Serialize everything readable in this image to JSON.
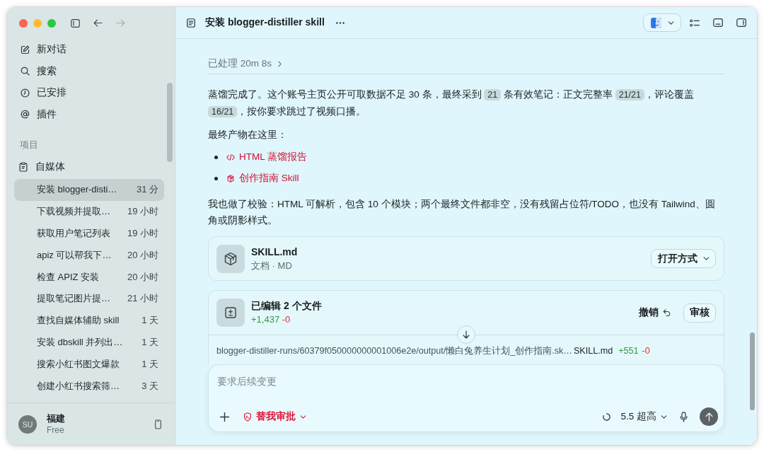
{
  "toolbar": {
    "back": {
      "disabled": false
    },
    "forward": {
      "disabled": true
    }
  },
  "sidebar": {
    "menu": [
      {
        "label": "新对话",
        "kind": "new"
      },
      {
        "label": "搜索",
        "kind": "search"
      },
      {
        "label": "已安排",
        "kind": "scheduled"
      },
      {
        "label": "插件",
        "kind": "plugins"
      }
    ],
    "section_label": "项目",
    "project": {
      "name": "自媒体",
      "threads": [
        {
          "title": "安装 blogger-disti…",
          "time": "31 分",
          "selected": true
        },
        {
          "title": "下载视频并提取…",
          "time": "19 小时",
          "selected": false
        },
        {
          "title": "获取用户笔记列表",
          "time": "19 小时",
          "selected": false
        },
        {
          "title": "apiz 可以帮我下…",
          "time": "20 小时",
          "selected": false
        },
        {
          "title": "检查 APIZ 安装",
          "time": "20 小时",
          "selected": false
        },
        {
          "title": "提取笔记图片提…",
          "time": "21 小时",
          "selected": false
        },
        {
          "title": "查找自媒体辅助 skill",
          "time": "1 天",
          "selected": false
        },
        {
          "title": "安装 dbskill 并列出…",
          "time": "1 天",
          "selected": false
        },
        {
          "title": "搜索小红书图文爆款",
          "time": "1 天",
          "selected": false
        },
        {
          "title": "创建小红书搜索筛…",
          "time": "3 天",
          "selected": false
        }
      ]
    },
    "user": {
      "initials": "SU",
      "name": "福建",
      "plan": "Free"
    }
  },
  "header": {
    "title": "安装 blogger-distiller skill"
  },
  "processed": {
    "label": "已处理 20m 8s",
    "expanded": false
  },
  "message": {
    "paragraph_1": [
      {
        "kind": "text",
        "text": "蒸馏完成了。这个账号主页公开可取数据不足 30 条，最终采到 "
      },
      {
        "kind": "code",
        "text": "21"
      },
      {
        "kind": "text",
        "text": " 条有效笔记：正文完整率 "
      },
      {
        "kind": "code",
        "text": "21/21"
      },
      {
        "kind": "text",
        "text": "，评论覆盖 "
      },
      {
        "kind": "code",
        "text": "16/21"
      },
      {
        "kind": "text",
        "text": "，按你要求跳过了视频口播。"
      }
    ],
    "products_label": "最终产物在这里：",
    "products": [
      {
        "label": "HTML 蒸馏报告",
        "kind": "html"
      },
      {
        "label": "创作指南 Skill",
        "kind": "skill"
      }
    ],
    "paragraph_2": "我也做了校验：HTML 可解析，包含 10 个模块；两个最终文件都非空，没有残留占位符/TODO，也没有 Tailwind、圆角或阴影样式。"
  },
  "file_card": {
    "name": "SKILL.md",
    "meta": "文档 · MD",
    "open_button": "打开方式"
  },
  "edits": {
    "title": "已编辑 2 个文件",
    "added": "+1,437",
    "removed": "-0",
    "undo": "撤销",
    "review": "审核",
    "files": [
      {
        "path": "blogger-distiller-runs/60379f050000000001006e2e/output/懒白兔养生计划_创作指南.sk…",
        "name": "SKILL.md",
        "added": "+551",
        "removed": "-0"
      }
    ]
  },
  "composer": {
    "placeholder": "要求后续变更",
    "approval": "替我审批",
    "model": "5.5 超高"
  }
}
